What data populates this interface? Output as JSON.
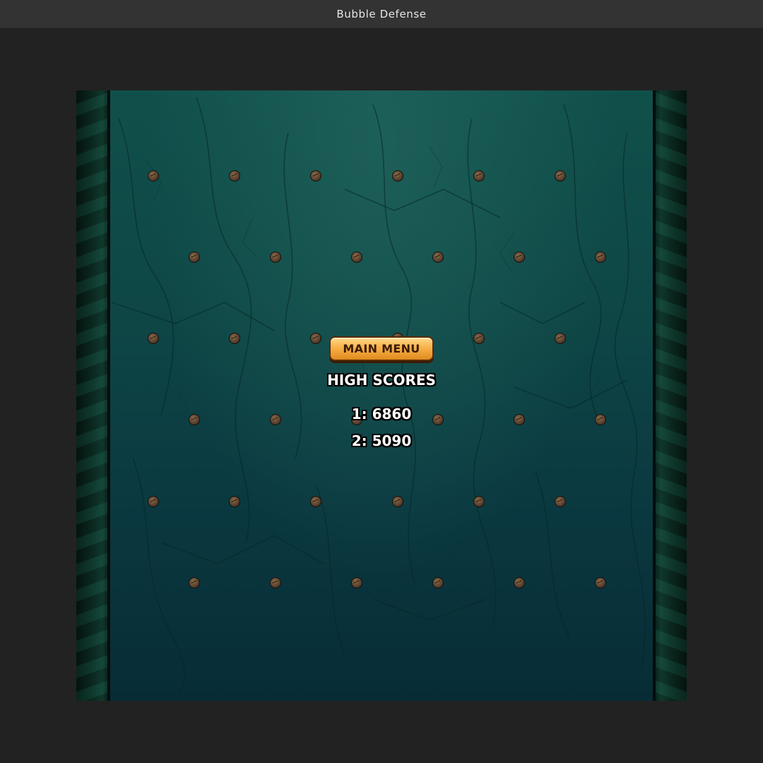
{
  "window": {
    "title": "Bubble Defense"
  },
  "menu": {
    "main_menu_label": "MAIN MENU"
  },
  "high_scores": {
    "heading": "HIGH SCORES",
    "entries": [
      {
        "rank": 1,
        "score": 6860,
        "text": "1: 6860"
      },
      {
        "rank": 2,
        "score": 5090,
        "text": "2: 5090"
      }
    ]
  },
  "colors": {
    "button_gold": "#f8b24a",
    "button_text": "#3a1a06",
    "background_teal": "#0e4746",
    "peg_brown": "#5c4330"
  },
  "board": {
    "peg_rows": 6,
    "peg_columns_even_rows": 6,
    "peg_columns_odd_rows": 6
  }
}
